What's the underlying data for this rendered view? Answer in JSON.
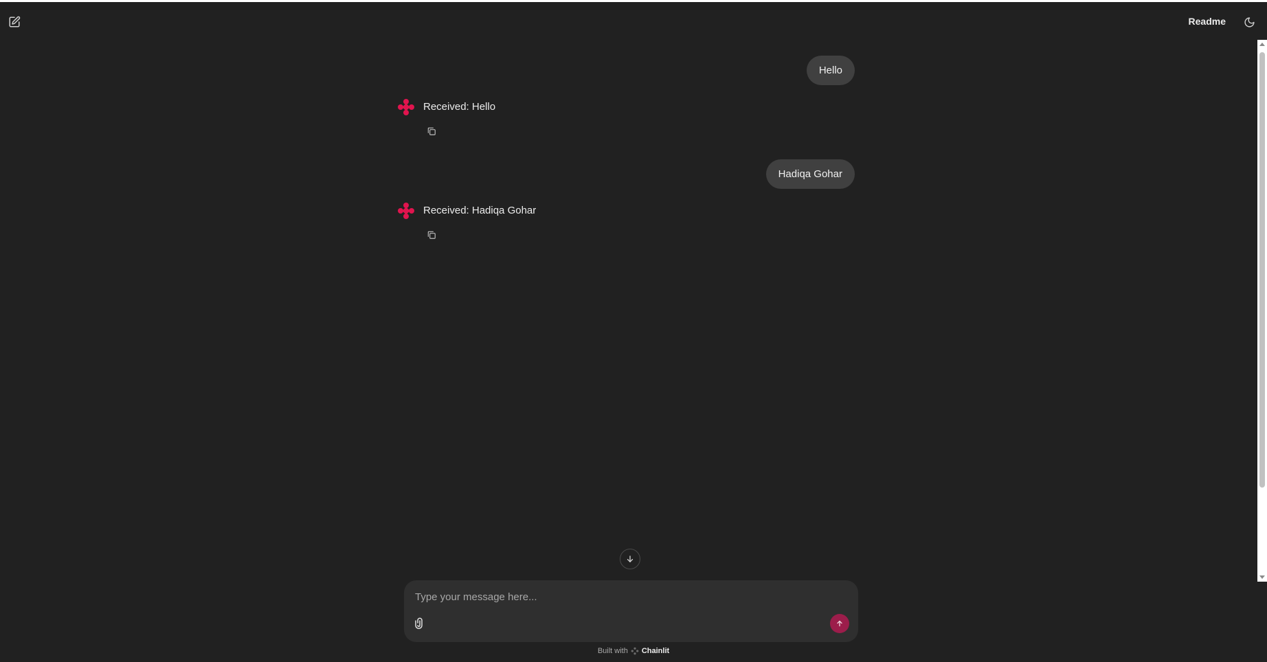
{
  "header": {
    "readme_label": "Readme",
    "new_chat_icon": "edit-icon",
    "theme_icon": "moon-icon"
  },
  "messages": [
    {
      "role": "user",
      "text": "Hello"
    },
    {
      "role": "assistant",
      "text": "Received: Hello"
    },
    {
      "role": "user",
      "text": "Hadiqa Gohar"
    },
    {
      "role": "assistant",
      "text": "Received: Hadiqa Gohar"
    }
  ],
  "composer": {
    "placeholder": "Type your message here...",
    "value": ""
  },
  "footer": {
    "built_with": "Built with",
    "brand": "Chainlit"
  },
  "colors": {
    "background": "#212121",
    "accent": "#e0144e",
    "send_button": "#9c1d4b",
    "user_bubble": "#404040"
  }
}
